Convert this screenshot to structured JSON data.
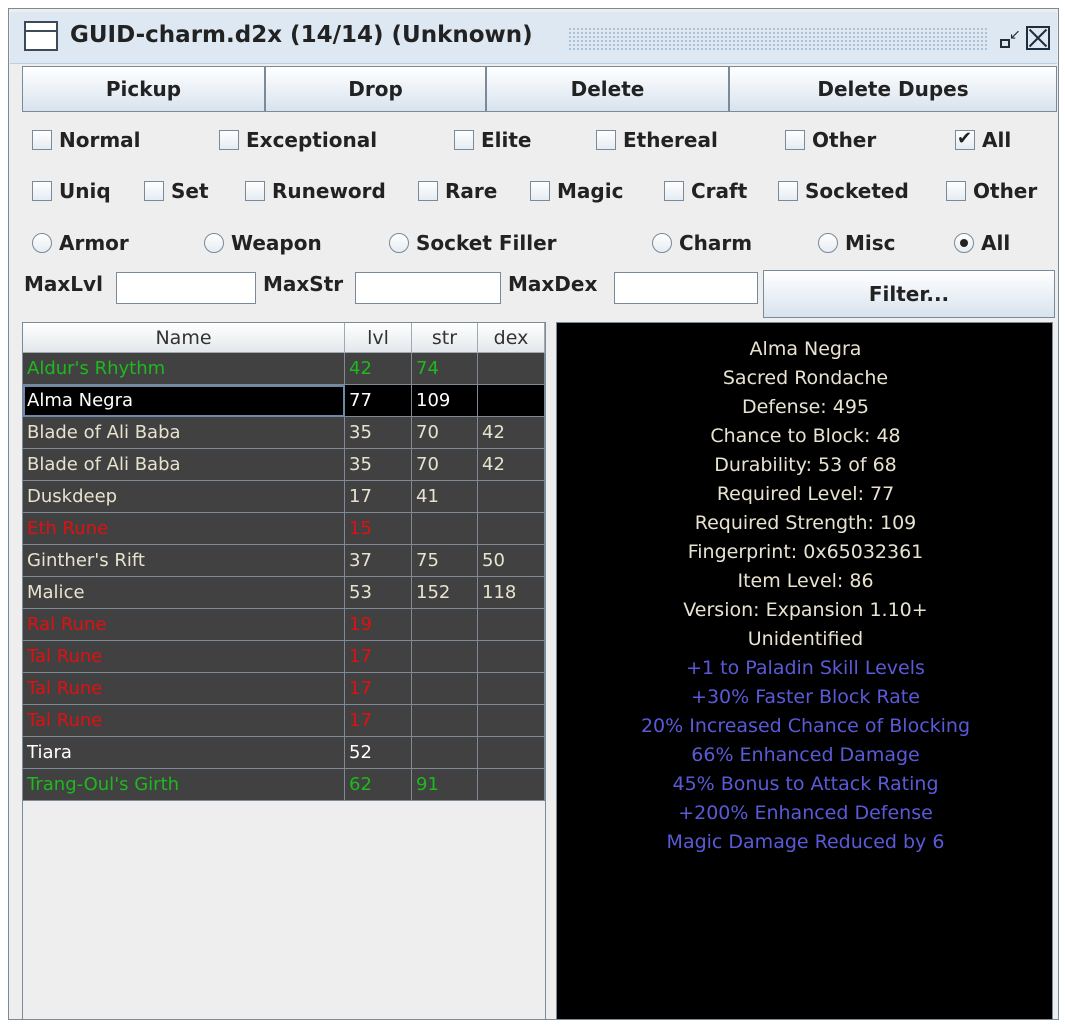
{
  "window": {
    "title": "GUID-charm.d2x (14/14) (Unknown)"
  },
  "actions": {
    "pickup": "Pickup",
    "drop": "Drop",
    "delete": "Delete",
    "delete_dupes": "Delete Dupes"
  },
  "quality_filters": [
    {
      "label": "Normal",
      "checked": false
    },
    {
      "label": "Exceptional",
      "checked": false
    },
    {
      "label": "Elite",
      "checked": false
    },
    {
      "label": "Ethereal",
      "checked": false
    },
    {
      "label": "Other",
      "checked": false
    },
    {
      "label": "All",
      "checked": true
    }
  ],
  "rarity_filters": [
    {
      "label": "Uniq",
      "checked": false
    },
    {
      "label": "Set",
      "checked": false
    },
    {
      "label": "Runeword",
      "checked": false
    },
    {
      "label": "Rare",
      "checked": false
    },
    {
      "label": "Magic",
      "checked": false
    },
    {
      "label": "Craft",
      "checked": false
    },
    {
      "label": "Socketed",
      "checked": false
    },
    {
      "label": "Other",
      "checked": false
    }
  ],
  "type_filters": [
    {
      "label": "Armor",
      "selected": false
    },
    {
      "label": "Weapon",
      "selected": false
    },
    {
      "label": "Socket Filler",
      "selected": false
    },
    {
      "label": "Charm",
      "selected": false
    },
    {
      "label": "Misc",
      "selected": false
    },
    {
      "label": "All",
      "selected": true
    }
  ],
  "stat_filters": {
    "max_lvl_label": "MaxLvl",
    "max_lvl_value": "",
    "max_str_label": "MaxStr",
    "max_str_value": "",
    "max_dex_label": "MaxDex",
    "max_dex_value": "",
    "filter_button": "Filter..."
  },
  "table": {
    "columns": [
      "Name",
      "lvl",
      "str",
      "dex"
    ],
    "rows": [
      {
        "name": "Aldur's Rhythm",
        "lvl": "42",
        "str": "74",
        "dex": "",
        "color": "#1fb81f",
        "selected": false
      },
      {
        "name": "Alma Negra",
        "lvl": "77",
        "str": "109",
        "dex": "",
        "color": "#ffffff",
        "selected": true
      },
      {
        "name": "Blade of Ali Baba",
        "lvl": "35",
        "str": "70",
        "dex": "42",
        "color": "#e8e2d0",
        "selected": false
      },
      {
        "name": "Blade of Ali Baba",
        "lvl": "35",
        "str": "70",
        "dex": "42",
        "color": "#e8e2d0",
        "selected": false
      },
      {
        "name": "Duskdeep",
        "lvl": "17",
        "str": "41",
        "dex": "",
        "color": "#e8e2d0",
        "selected": false
      },
      {
        "name": "Eth Rune",
        "lvl": "15",
        "str": "",
        "dex": "",
        "color": "#e01010",
        "selected": false
      },
      {
        "name": "Ginther's Rift",
        "lvl": "37",
        "str": "75",
        "dex": "50",
        "color": "#e8e2d0",
        "selected": false
      },
      {
        "name": "Malice",
        "lvl": "53",
        "str": "152",
        "dex": "118",
        "color": "#e8e2d0",
        "selected": false
      },
      {
        "name": "Ral Rune",
        "lvl": "19",
        "str": "",
        "dex": "",
        "color": "#e01010",
        "selected": false
      },
      {
        "name": "Tal Rune",
        "lvl": "17",
        "str": "",
        "dex": "",
        "color": "#e01010",
        "selected": false
      },
      {
        "name": "Tal Rune",
        "lvl": "17",
        "str": "",
        "dex": "",
        "color": "#e01010",
        "selected": false
      },
      {
        "name": "Tal Rune",
        "lvl": "17",
        "str": "",
        "dex": "",
        "color": "#e01010",
        "selected": false
      },
      {
        "name": "Tiara",
        "lvl": "52",
        "str": "",
        "dex": "",
        "color": "#ffffff",
        "selected": false
      },
      {
        "name": "Trang-Oul's Girth",
        "lvl": "62",
        "str": "91",
        "dex": "",
        "color": "#1fb81f",
        "selected": false
      }
    ]
  },
  "details": {
    "base_lines": [
      "Alma Negra",
      "Sacred Rondache",
      "Defense: 495",
      "Chance to Block: 48",
      "Durability: 53 of 68",
      "Required Level: 77",
      "Required Strength: 109",
      "Fingerprint: 0x65032361",
      "Item Level: 86",
      "Version: Expansion 1.10+",
      "Unidentified"
    ],
    "magic_lines": [
      "+1 to Paladin Skill Levels",
      "+30% Faster Block Rate",
      "20% Increased Chance of Blocking",
      "66% Enhanced Damage",
      "45% Bonus to Attack Rating",
      "+200% Enhanced Defense",
      "Magic Damage Reduced by 6"
    ],
    "base_color": "#e8e2d0",
    "magic_color": "#5a5ad8"
  }
}
